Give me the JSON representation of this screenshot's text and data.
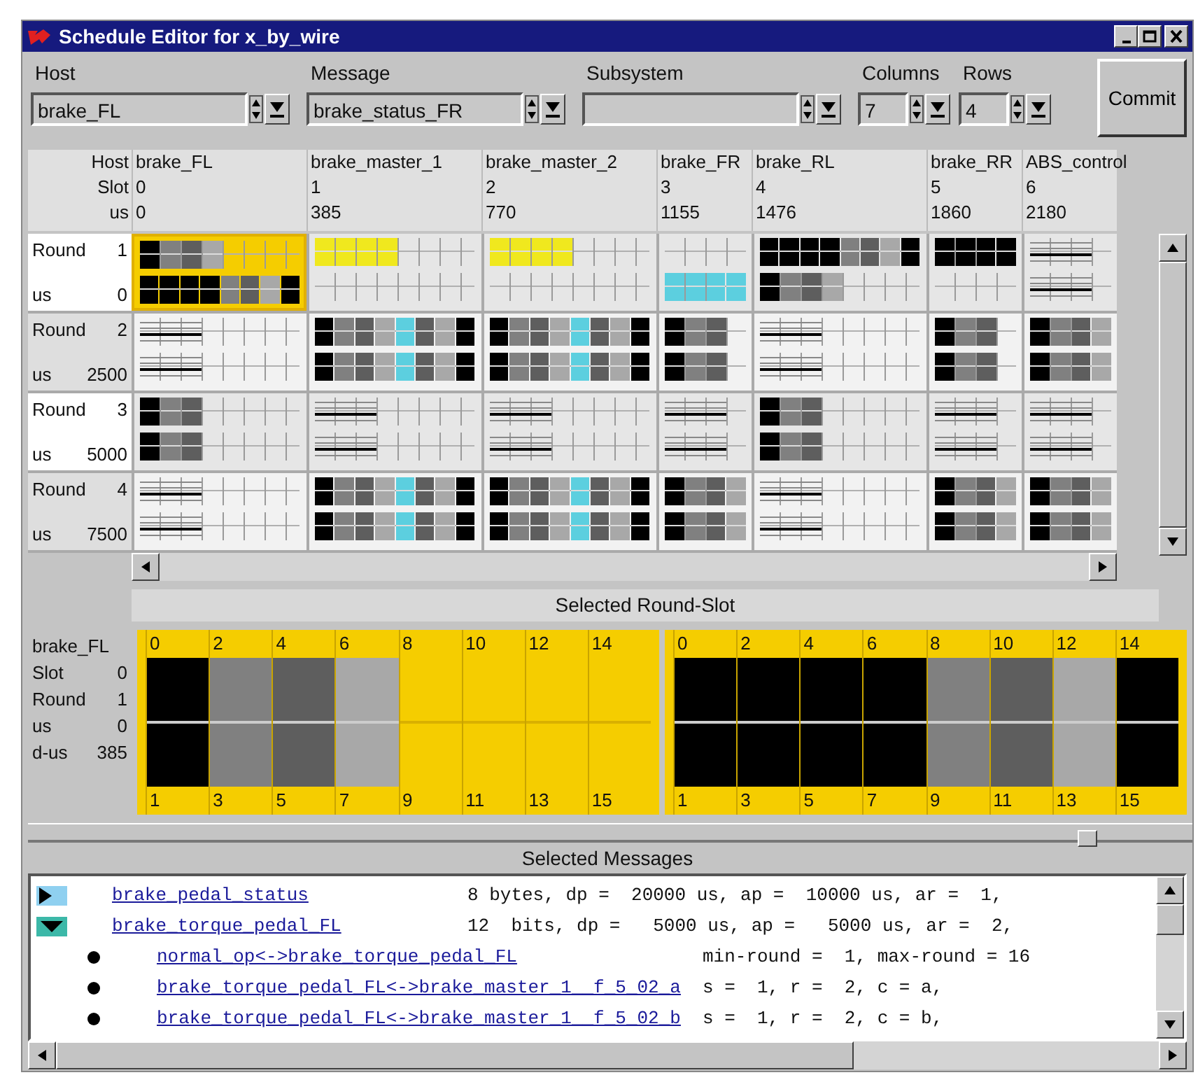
{
  "window": {
    "title": "Schedule Editor for x_by_wire"
  },
  "selectors": [
    {
      "label": "Host",
      "value": "brake_FL",
      "kind": "text"
    },
    {
      "label": "Message",
      "value": "brake_status_FR",
      "kind": "text"
    },
    {
      "label": "Subsystem",
      "kind": "text"
    },
    {
      "label": "Columns",
      "value": "7",
      "kind": "number"
    },
    {
      "label": "Rows",
      "value": "4",
      "kind": "number"
    }
  ],
  "commit_button": "Commit",
  "header_labels": [
    "Host",
    "Slot",
    "us"
  ],
  "columns": [
    {
      "host": "brake_FL",
      "slot": "0",
      "us": "0",
      "wide": true
    },
    {
      "host": "brake_master_1",
      "slot": "1",
      "us": "385",
      "wide": true
    },
    {
      "host": "brake_master_2",
      "slot": "2",
      "us": "770",
      "wide": true
    },
    {
      "host": "brake_FR",
      "slot": "3",
      "us": "1155",
      "wide": false
    },
    {
      "host": "brake_RL",
      "slot": "4",
      "us": "1476",
      "wide": true
    },
    {
      "host": "brake_RR",
      "slot": "5",
      "us": "1860",
      "wide": false
    },
    {
      "host": "ABS_control",
      "slot": "6",
      "us": "2180",
      "wide": false
    }
  ],
  "rounds": [
    {
      "label": "Round",
      "number": "1",
      "us_label": "us",
      "us": "0",
      "cells": [
        {
          "selected": true,
          "lanes": [
            {
              "kind": "blocks",
              "blocks": [
                {
                  "color": "#000000"
                },
                {
                  "color": "#808080"
                },
                {
                  "color": "#5e5e5e"
                },
                {
                  "color": "#a8a8a8"
                }
              ]
            },
            {
              "kind": "blocks",
              "blocks": [
                {
                  "color": "#000000"
                },
                {
                  "color": "#000000"
                },
                {
                  "color": "#000000"
                },
                {
                  "color": "#000000"
                },
                {
                  "color": "#808080"
                },
                {
                  "color": "#5e5e5e"
                },
                {
                  "color": "#a8a8a8"
                },
                {
                  "color": "#000000"
                }
              ]
            }
          ]
        },
        {
          "selected": false,
          "lanes": [
            {
              "kind": "blocks",
              "blocks": [
                {
                  "color": "#f0e81e"
                },
                {
                  "color": "#f0e81e"
                },
                {
                  "color": "#f0e81e"
                },
                {
                  "color": "#f0e81e"
                }
              ]
            },
            {
              "kind": "empty"
            }
          ]
        },
        {
          "selected": false,
          "lanes": [
            {
              "kind": "blocks",
              "blocks": [
                {
                  "color": "#f0e81e"
                },
                {
                  "color": "#f0e81e"
                },
                {
                  "color": "#f0e81e"
                },
                {
                  "color": "#f0e81e"
                }
              ]
            },
            {
              "kind": "empty"
            }
          ]
        },
        {
          "selected": false,
          "lanes": [
            {
              "kind": "empty"
            },
            {
              "kind": "blocks",
              "blocks": [
                {
                  "color": "#5ccfdf"
                },
                {
                  "color": "#5ccfdf"
                },
                {
                  "color": "#5ccfdf"
                },
                {
                  "color": "#5ccfdf"
                }
              ]
            }
          ]
        },
        {
          "selected": false,
          "lanes": [
            {
              "kind": "blocks",
              "blocks": [
                {
                  "color": "#000000"
                },
                {
                  "color": "#000000"
                },
                {
                  "color": "#000000"
                },
                {
                  "color": "#000000"
                },
                {
                  "color": "#808080"
                },
                {
                  "color": "#5e5e5e"
                },
                {
                  "color": "#a8a8a8"
                },
                {
                  "color": "#000000"
                }
              ]
            },
            {
              "kind": "blocks",
              "blocks": [
                {
                  "color": "#000000"
                },
                {
                  "color": "#808080"
                },
                {
                  "color": "#5e5e5e"
                },
                {
                  "color": "#a8a8a8"
                }
              ]
            }
          ]
        },
        {
          "selected": false,
          "lanes": [
            {
              "kind": "blocks",
              "blocks": [
                {
                  "color": "#000000"
                },
                {
                  "color": "#000000"
                },
                {
                  "color": "#000000"
                },
                {
                  "color": "#000000"
                }
              ]
            },
            {
              "kind": "empty"
            }
          ]
        },
        {
          "selected": false,
          "lanes": [
            {
              "kind": "lines"
            },
            {
              "kind": "lines"
            }
          ]
        }
      ]
    },
    {
      "label": "Round",
      "number": "2",
      "us_label": "us",
      "us": "2500",
      "cells": [
        {
          "selected": false,
          "lanes": [
            {
              "kind": "lines"
            },
            {
              "kind": "lines"
            }
          ]
        },
        {
          "selected": false,
          "lanes": [
            {
              "kind": "blocks",
              "blocks": [
                {
                  "color": "#000000"
                },
                {
                  "color": "#808080"
                },
                {
                  "color": "#5e5e5e"
                },
                {
                  "color": "#a8a8a8"
                },
                {
                  "color": "#5ccfdf"
                },
                {
                  "color": "#5e5e5e"
                },
                {
                  "color": "#a8a8a8"
                },
                {
                  "color": "#000000"
                }
              ]
            },
            {
              "kind": "blocks",
              "blocks": [
                {
                  "color": "#000000"
                },
                {
                  "color": "#808080"
                },
                {
                  "color": "#5e5e5e"
                },
                {
                  "color": "#a8a8a8"
                },
                {
                  "color": "#5ccfdf"
                },
                {
                  "color": "#5e5e5e"
                },
                {
                  "color": "#a8a8a8"
                },
                {
                  "color": "#000000"
                }
              ]
            }
          ]
        },
        {
          "selected": false,
          "lanes": [
            {
              "kind": "blocks",
              "blocks": [
                {
                  "color": "#000000"
                },
                {
                  "color": "#808080"
                },
                {
                  "color": "#5e5e5e"
                },
                {
                  "color": "#a8a8a8"
                },
                {
                  "color": "#5ccfdf"
                },
                {
                  "color": "#5e5e5e"
                },
                {
                  "color": "#a8a8a8"
                },
                {
                  "color": "#000000"
                }
              ]
            },
            {
              "kind": "blocks",
              "blocks": [
                {
                  "color": "#000000"
                },
                {
                  "color": "#808080"
                },
                {
                  "color": "#5e5e5e"
                },
                {
                  "color": "#a8a8a8"
                },
                {
                  "color": "#5ccfdf"
                },
                {
                  "color": "#5e5e5e"
                },
                {
                  "color": "#a8a8a8"
                },
                {
                  "color": "#000000"
                }
              ]
            }
          ]
        },
        {
          "selected": false,
          "lanes": [
            {
              "kind": "blocks",
              "blocks": [
                {
                  "color": "#000000"
                },
                {
                  "color": "#808080"
                },
                {
                  "color": "#5e5e5e"
                }
              ]
            },
            {
              "kind": "blocks",
              "blocks": [
                {
                  "color": "#000000"
                },
                {
                  "color": "#808080"
                },
                {
                  "color": "#5e5e5e"
                }
              ]
            }
          ]
        },
        {
          "selected": false,
          "lanes": [
            {
              "kind": "lines"
            },
            {
              "kind": "lines"
            }
          ]
        },
        {
          "selected": false,
          "lanes": [
            {
              "kind": "blocks",
              "blocks": [
                {
                  "color": "#000000"
                },
                {
                  "color": "#808080"
                },
                {
                  "color": "#5e5e5e"
                }
              ]
            },
            {
              "kind": "blocks",
              "blocks": [
                {
                  "color": "#000000"
                },
                {
                  "color": "#808080"
                },
                {
                  "color": "#5e5e5e"
                }
              ]
            }
          ]
        },
        {
          "selected": false,
          "lanes": [
            {
              "kind": "blocks",
              "blocks": [
                {
                  "color": "#000000"
                },
                {
                  "color": "#808080"
                },
                {
                  "color": "#5e5e5e"
                },
                {
                  "color": "#a8a8a8"
                }
              ]
            },
            {
              "kind": "blocks",
              "blocks": [
                {
                  "color": "#000000"
                },
                {
                  "color": "#808080"
                },
                {
                  "color": "#5e5e5e"
                },
                {
                  "color": "#a8a8a8"
                }
              ]
            }
          ]
        }
      ]
    },
    {
      "label": "Round",
      "number": "3",
      "us_label": "us",
      "us": "5000",
      "cells": [
        {
          "selected": false,
          "lanes": [
            {
              "kind": "blocks",
              "blocks": [
                {
                  "color": "#000000"
                },
                {
                  "color": "#808080"
                },
                {
                  "color": "#5e5e5e"
                }
              ]
            },
            {
              "kind": "blocks",
              "blocks": [
                {
                  "color": "#000000"
                },
                {
                  "color": "#808080"
                },
                {
                  "color": "#5e5e5e"
                }
              ]
            }
          ]
        },
        {
          "selected": false,
          "lanes": [
            {
              "kind": "lines"
            },
            {
              "kind": "lines"
            }
          ]
        },
        {
          "selected": false,
          "lanes": [
            {
              "kind": "lines"
            },
            {
              "kind": "lines"
            }
          ]
        },
        {
          "selected": false,
          "lanes": [
            {
              "kind": "lines"
            },
            {
              "kind": "lines"
            }
          ]
        },
        {
          "selected": false,
          "lanes": [
            {
              "kind": "blocks",
              "blocks": [
                {
                  "color": "#000000"
                },
                {
                  "color": "#808080"
                },
                {
                  "color": "#5e5e5e"
                }
              ]
            },
            {
              "kind": "blocks",
              "blocks": [
                {
                  "color": "#000000"
                },
                {
                  "color": "#808080"
                },
                {
                  "color": "#5e5e5e"
                }
              ]
            }
          ]
        },
        {
          "selected": false,
          "lanes": [
            {
              "kind": "lines"
            },
            {
              "kind": "lines"
            }
          ]
        },
        {
          "selected": false,
          "lanes": [
            {
              "kind": "lines"
            },
            {
              "kind": "lines"
            }
          ]
        }
      ]
    },
    {
      "label": "Round",
      "number": "4",
      "us_label": "us",
      "us": "7500",
      "cells": [
        {
          "selected": false,
          "lanes": [
            {
              "kind": "lines"
            },
            {
              "kind": "lines"
            }
          ]
        },
        {
          "selected": false,
          "lanes": [
            {
              "kind": "blocks",
              "blocks": [
                {
                  "color": "#000000"
                },
                {
                  "color": "#808080"
                },
                {
                  "color": "#5e5e5e"
                },
                {
                  "color": "#a8a8a8"
                },
                {
                  "color": "#5ccfdf"
                },
                {
                  "color": "#5e5e5e"
                },
                {
                  "color": "#a8a8a8"
                },
                {
                  "color": "#000000"
                }
              ]
            },
            {
              "kind": "blocks",
              "blocks": [
                {
                  "color": "#000000"
                },
                {
                  "color": "#808080"
                },
                {
                  "color": "#5e5e5e"
                },
                {
                  "color": "#a8a8a8"
                },
                {
                  "color": "#5ccfdf"
                },
                {
                  "color": "#5e5e5e"
                },
                {
                  "color": "#a8a8a8"
                },
                {
                  "color": "#000000"
                }
              ]
            }
          ]
        },
        {
          "selected": false,
          "lanes": [
            {
              "kind": "blocks",
              "blocks": [
                {
                  "color": "#000000"
                },
                {
                  "color": "#808080"
                },
                {
                  "color": "#5e5e5e"
                },
                {
                  "color": "#a8a8a8"
                },
                {
                  "color": "#5ccfdf"
                },
                {
                  "color": "#5e5e5e"
                },
                {
                  "color": "#a8a8a8"
                },
                {
                  "color": "#000000"
                }
              ]
            },
            {
              "kind": "blocks",
              "blocks": [
                {
                  "color": "#000000"
                },
                {
                  "color": "#808080"
                },
                {
                  "color": "#5e5e5e"
                },
                {
                  "color": "#a8a8a8"
                },
                {
                  "color": "#5ccfdf"
                },
                {
                  "color": "#5e5e5e"
                },
                {
                  "color": "#a8a8a8"
                },
                {
                  "color": "#000000"
                }
              ]
            }
          ]
        },
        {
          "selected": false,
          "lanes": [
            {
              "kind": "blocks",
              "blocks": [
                {
                  "color": "#000000"
                },
                {
                  "color": "#808080"
                },
                {
                  "color": "#5e5e5e"
                },
                {
                  "color": "#a8a8a8"
                }
              ]
            },
            {
              "kind": "blocks",
              "blocks": [
                {
                  "color": "#000000"
                },
                {
                  "color": "#808080"
                },
                {
                  "color": "#5e5e5e"
                },
                {
                  "color": "#a8a8a8"
                }
              ]
            }
          ]
        },
        {
          "selected": false,
          "lanes": [
            {
              "kind": "lines"
            },
            {
              "kind": "lines"
            }
          ]
        },
        {
          "selected": false,
          "lanes": [
            {
              "kind": "blocks",
              "blocks": [
                {
                  "color": "#000000"
                },
                {
                  "color": "#808080"
                },
                {
                  "color": "#5e5e5e"
                },
                {
                  "color": "#a8a8a8"
                }
              ]
            },
            {
              "kind": "blocks",
              "blocks": [
                {
                  "color": "#000000"
                },
                {
                  "color": "#808080"
                },
                {
                  "color": "#5e5e5e"
                },
                {
                  "color": "#a8a8a8"
                }
              ]
            }
          ]
        },
        {
          "selected": false,
          "lanes": [
            {
              "kind": "blocks",
              "blocks": [
                {
                  "color": "#000000"
                },
                {
                  "color": "#808080"
                },
                {
                  "color": "#5e5e5e"
                },
                {
                  "color": "#a8a8a8"
                }
              ]
            },
            {
              "kind": "blocks",
              "blocks": [
                {
                  "color": "#000000"
                },
                {
                  "color": "#808080"
                },
                {
                  "color": "#5e5e5e"
                },
                {
                  "color": "#a8a8a8"
                }
              ]
            }
          ]
        }
      ]
    }
  ],
  "selected_round_slot": {
    "title": "Selected Round-Slot",
    "host": "brake_FL",
    "fields": [
      {
        "label": "Slot",
        "value": "0"
      },
      {
        "label": "Round",
        "value": "1"
      },
      {
        "label": "us",
        "value": "0"
      },
      {
        "label": "d-us",
        "value": "385"
      }
    ],
    "panels": [
      {
        "top_ticks": [
          "0",
          "2",
          "4",
          "6",
          "8",
          "10",
          "12",
          "14"
        ],
        "bottom_ticks": [
          "1",
          "3",
          "5",
          "7",
          "9",
          "11",
          "13",
          "15"
        ],
        "blocks": [
          {
            "color": "#000000"
          },
          {
            "color": "#808080"
          },
          {
            "color": "#5e5e5e"
          },
          {
            "color": "#a8a8a8"
          }
        ]
      },
      {
        "top_ticks": [
          "0",
          "2",
          "4",
          "6",
          "8",
          "10",
          "12",
          "14"
        ],
        "bottom_ticks": [
          "1",
          "3",
          "5",
          "7",
          "9",
          "11",
          "13",
          "15"
        ],
        "blocks": [
          {
            "color": "#000000"
          },
          {
            "color": "#000000"
          },
          {
            "color": "#000000"
          },
          {
            "color": "#000000"
          },
          {
            "color": "#808080"
          },
          {
            "color": "#5e5e5e"
          },
          {
            "color": "#a8a8a8"
          },
          {
            "color": "#000000"
          }
        ]
      }
    ]
  },
  "selected_messages": {
    "title": "Selected Messages",
    "items": [
      {
        "kind": "message",
        "expanded": false,
        "name": "brake_pedal_status",
        "details": "8 bytes, dp =  20000 us, ap =  10000 us, ar =  1,"
      },
      {
        "kind": "message",
        "expanded": true,
        "name": "brake_torque_pedal_FL",
        "details": "12  bits, dp =   5000 us, ap =   5000 us, ar =  2,",
        "children": [
          {
            "kind": "link",
            "name": "normal_op<->brake_torque_pedal_FL",
            "details": "min-round =  1, max-round = 16"
          },
          {
            "kind": "link",
            "name": "brake_torque_pedal_FL<->brake_master_1__f_5_02_a",
            "details": "s =  1, r =  2, c = a,"
          },
          {
            "kind": "link",
            "name": "brake_torque_pedal_FL<->brake_master_1__f_5_02_b",
            "details": "s =  1, r =  2, c = b,"
          }
        ]
      }
    ]
  }
}
